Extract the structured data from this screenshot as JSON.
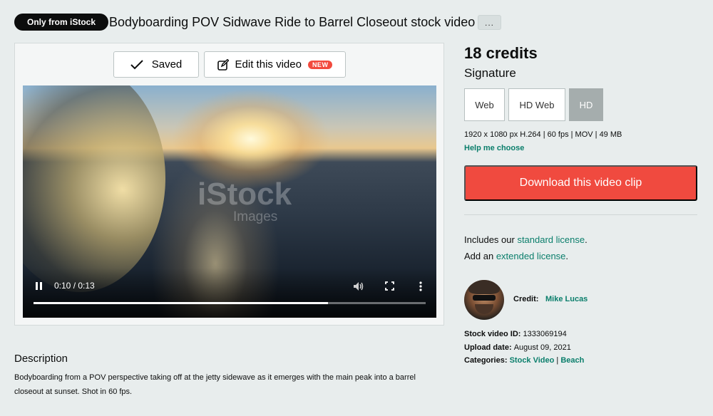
{
  "header": {
    "badge": "Only from iStock",
    "title": "Bodyboarding POV Sidwave Ride to Barrel Closeout stock video",
    "more_label": "..."
  },
  "player": {
    "saved_label": "Saved",
    "edit_label": "Edit this video",
    "new_badge": "NEW",
    "watermark": "iStock",
    "watermark_sub": "Images",
    "time": "0:10 / 0:13",
    "progress": 0.75,
    "icons": [
      "check-icon",
      "edit-icon",
      "pause-icon",
      "volume-icon",
      "fullscreen-icon",
      "more-vertical-icon"
    ]
  },
  "pricing": {
    "credits": "18 credits",
    "tier": "Signature",
    "sizes": [
      {
        "label": "Web",
        "selected": false
      },
      {
        "label": "HD Web",
        "selected": false
      },
      {
        "label": "HD",
        "selected": true
      }
    ],
    "spec": "1920 x 1080 px H.264 | 60 fps | MOV | 49 MB",
    "help_link": "Help me choose",
    "download_label": "Download this video clip"
  },
  "license": {
    "includes_prefix": "Includes our ",
    "standard_link": "standard license",
    "includes_suffix": ".",
    "add_prefix": "Add an ",
    "extended_link": "extended license",
    "add_suffix": "."
  },
  "credit": {
    "label": "Credit:",
    "name": "Mike Lucas"
  },
  "details": {
    "id_label": "Stock video ID:",
    "id_value": "1333069194",
    "date_label": "Upload date:",
    "date_value": "August 09, 2021",
    "cat_label": "Categories:",
    "categories": [
      "Stock Video",
      "Beach"
    ],
    "cat_sep": "|"
  },
  "description": {
    "heading": "Description",
    "text": "Bodyboarding from a POV perspective taking off at the jetty sidewave as it emerges with the main peak into a barrel closeout at sunset. Shot in 60 fps."
  },
  "colors": {
    "accent": "#f04a3f",
    "link": "#0a7e6b",
    "background": "#e8eded"
  }
}
